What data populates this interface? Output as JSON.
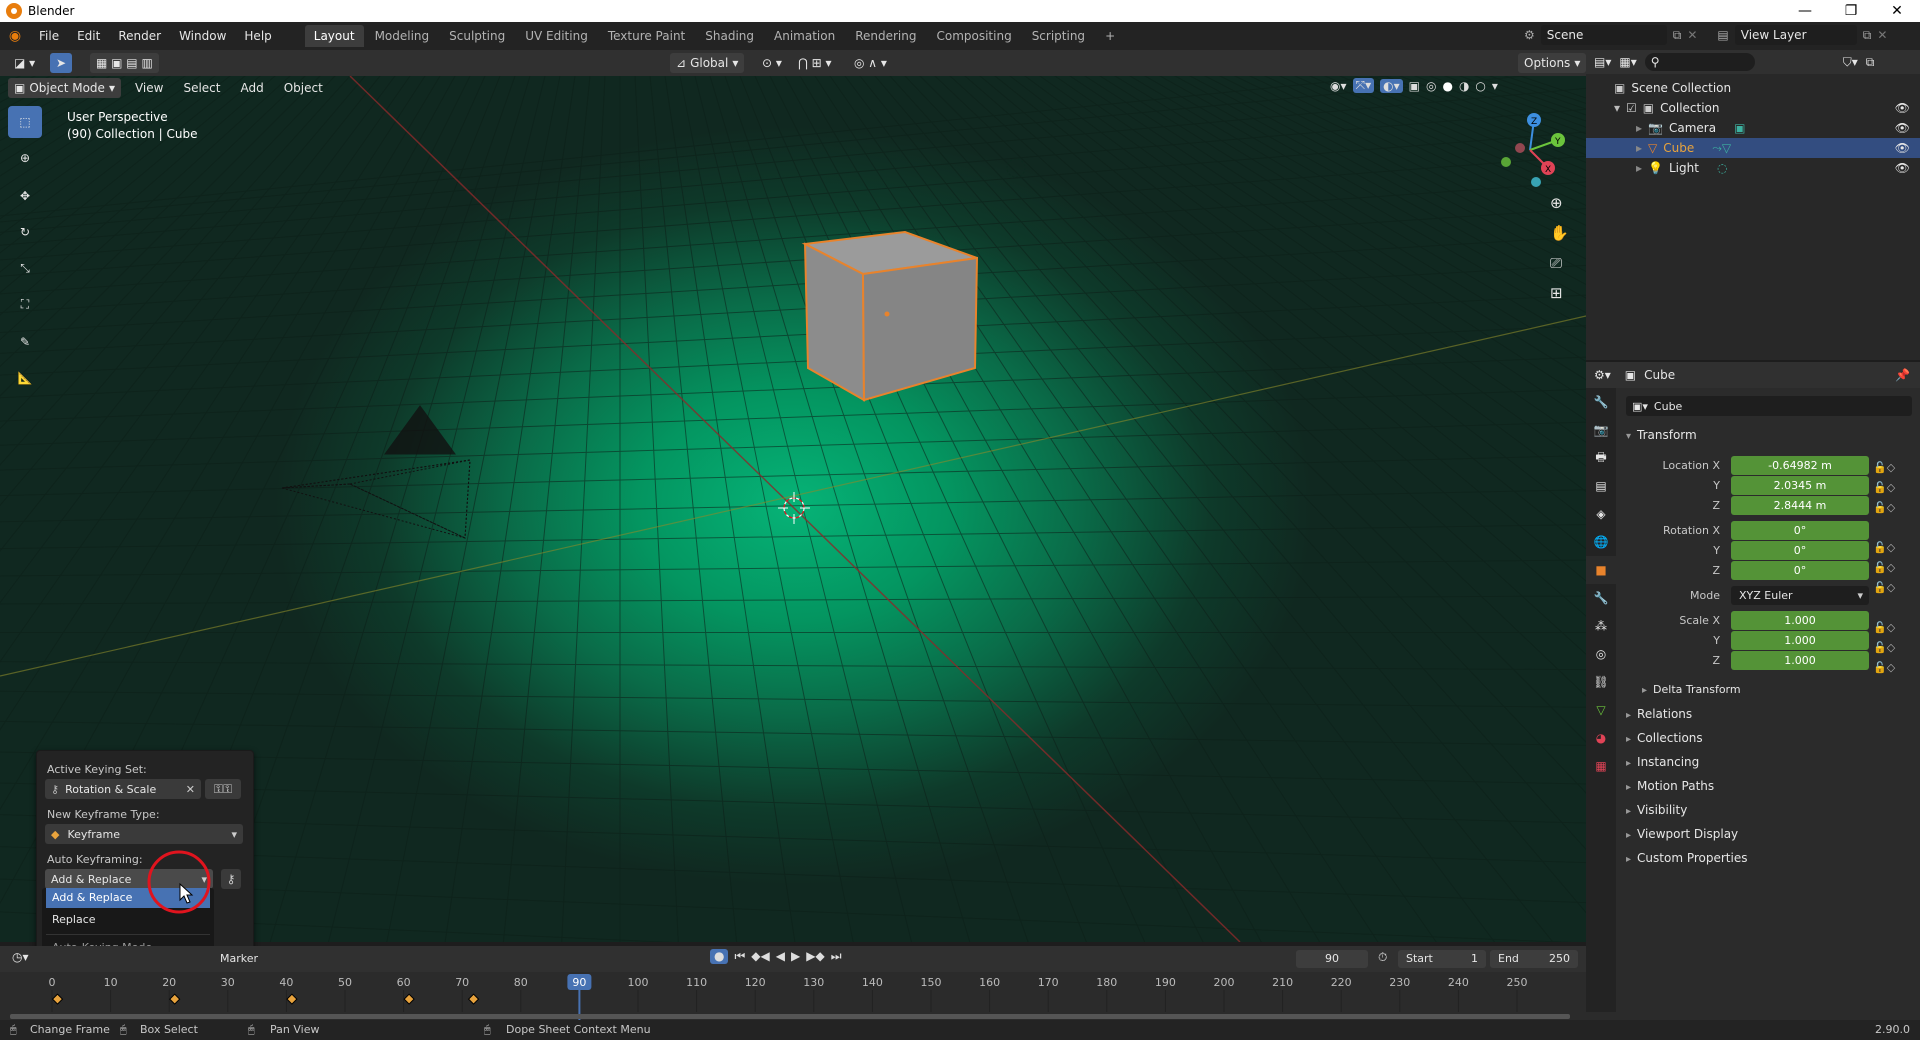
{
  "window": {
    "title": "Blender",
    "controls": [
      "—",
      "❐",
      "✕"
    ]
  },
  "menu": [
    "File",
    "Edit",
    "Render",
    "Window",
    "Help"
  ],
  "workspaces": [
    "Layout",
    "Modeling",
    "Sculpting",
    "UV Editing",
    "Texture Paint",
    "Shading",
    "Animation",
    "Rendering",
    "Compositing",
    "Scripting",
    "+"
  ],
  "active_workspace": "Layout",
  "scene": {
    "label": "Scene",
    "view_layer": "View Layer"
  },
  "viewport_header": {
    "transform_orientation": "Global",
    "options": "Options",
    "mode": "Object Mode",
    "menus": [
      "View",
      "Select",
      "Add",
      "Object"
    ]
  },
  "viewport": {
    "perspective": "User Perspective",
    "collection_info": "(90) Collection | Cube"
  },
  "outliner": {
    "scene_collection": "Scene Collection",
    "collection": "Collection",
    "items": [
      {
        "name": "Camera",
        "selected": false
      },
      {
        "name": "Cube",
        "selected": true
      },
      {
        "name": "Light",
        "selected": false
      }
    ]
  },
  "properties": {
    "object_name_header": "Cube",
    "object_name_field": "Cube",
    "transform_title": "Transform",
    "location_label": "Location X",
    "location": [
      "-0.64982 m",
      "2.0345 m",
      "2.8444 m"
    ],
    "rotation_label": "Rotation X",
    "rotation": [
      "0°",
      "0°",
      "0°"
    ],
    "mode_label": "Mode",
    "mode_value": "XYZ Euler",
    "scale_label": "Scale X",
    "scale": [
      "1.000",
      "1.000",
      "1.000"
    ],
    "axis_y": "Y",
    "axis_z": "Z",
    "delta_transform": "Delta Transform",
    "sections": [
      "Relations",
      "Collections",
      "Instancing",
      "Motion Paths",
      "Visibility",
      "Viewport Display",
      "Custom Properties"
    ]
  },
  "keying_popup": {
    "active_keying_set_label": "Active Keying Set:",
    "active_keying_set": "Rotation & Scale",
    "new_keyframe_type_label": "New Keyframe Type:",
    "new_keyframe_type": "Keyframe",
    "auto_keyframing_label": "Auto Keyframing:",
    "auto_keyframing_value": "Add & Replace",
    "dropdown_options": [
      "Add & Replace",
      "Replace"
    ],
    "dropdown_footer": "Auto-Keying Mode"
  },
  "timeline": {
    "marker_menu": "Marker",
    "current_frame": "90",
    "start_label": "Start",
    "start": "1",
    "end_label": "End",
    "end": "250",
    "ruler": [
      0,
      10,
      20,
      30,
      40,
      50,
      60,
      70,
      80,
      90,
      100,
      110,
      120,
      130,
      140,
      150,
      160,
      170,
      180,
      190,
      200,
      210,
      220,
      230,
      240,
      250
    ],
    "keyframes": [
      1,
      21,
      41,
      61,
      72
    ]
  },
  "statusbar": {
    "items": [
      "Change Frame",
      "Box Select",
      "Pan View",
      "Dope Sheet Context Menu"
    ],
    "version": "2.90.0"
  },
  "colors": {
    "accent": "#4772b3",
    "field_green": "#549337",
    "keyframe": "#e8a33d",
    "selection_orange": "#e8832c",
    "click_marker": "#e0141e"
  }
}
